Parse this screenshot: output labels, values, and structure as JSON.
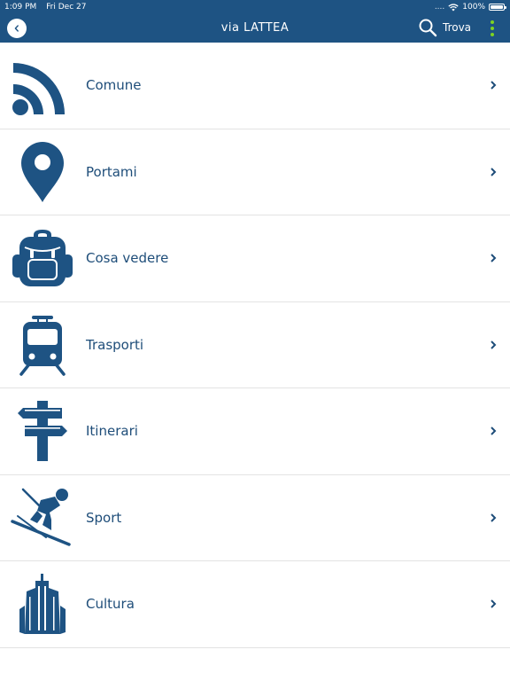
{
  "status_bar": {
    "time": "1:09 PM",
    "date": "Fri Dec 27",
    "battery": "100%",
    "battery_level": 1.0
  },
  "header": {
    "title": "via LATTEA",
    "search_label": "Trova"
  },
  "menu": {
    "items": [
      {
        "label": "Comune",
        "icon": "rss-icon"
      },
      {
        "label": "Portami",
        "icon": "map-pin-icon"
      },
      {
        "label": "Cosa vedere",
        "icon": "backpack-icon"
      },
      {
        "label": "Trasporti",
        "icon": "train-icon"
      },
      {
        "label": "Itinerari",
        "icon": "signpost-icon"
      },
      {
        "label": "Sport",
        "icon": "skier-icon"
      },
      {
        "label": "Cultura",
        "icon": "building-icon"
      }
    ]
  },
  "colors": {
    "header_bg": "#1e5383",
    "icon": "#1e5383",
    "label": "#1e4d79",
    "more_dots": "#7ed321"
  }
}
